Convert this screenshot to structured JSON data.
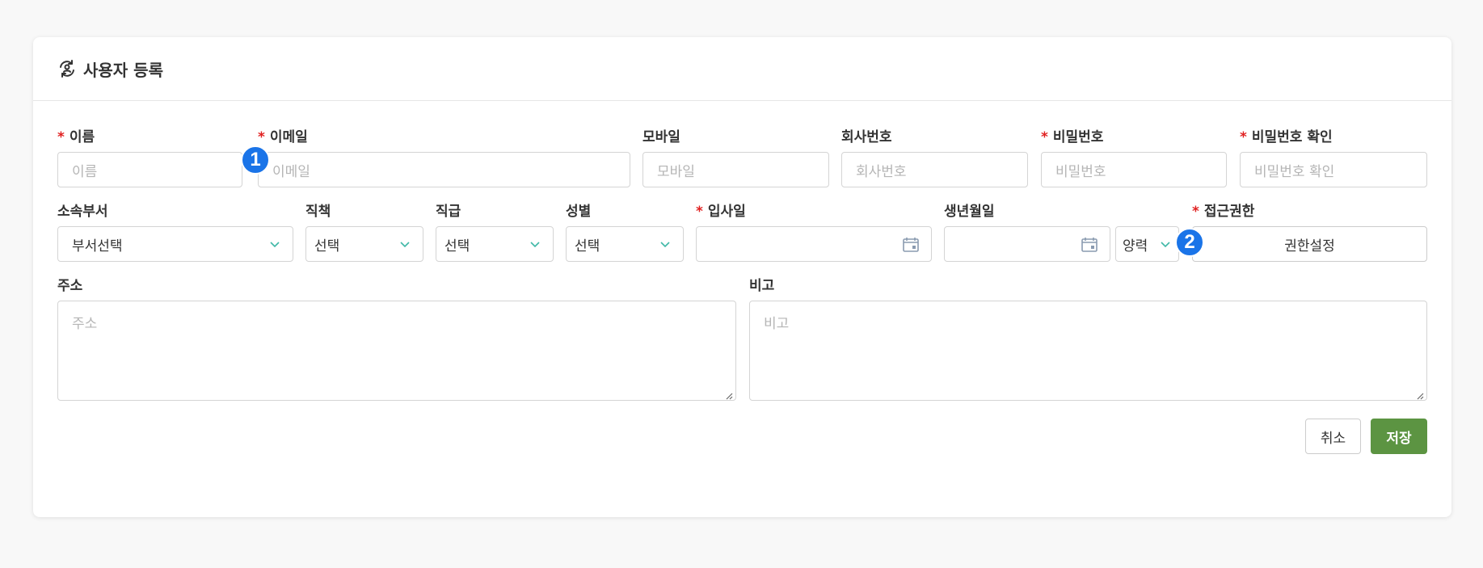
{
  "header": {
    "title": "사용자 등록",
    "icon": "user-sync-icon"
  },
  "form": {
    "row1": {
      "name": {
        "label": "이름",
        "required": "*",
        "placeholder": "이름"
      },
      "email": {
        "label": "이메일",
        "required": "*",
        "placeholder": "이메일"
      },
      "mobile": {
        "label": "모바일",
        "placeholder": "모바일"
      },
      "company_no": {
        "label": "회사번호",
        "placeholder": "회사번호"
      },
      "password": {
        "label": "비밀번호",
        "required": "*",
        "placeholder": "비밀번호"
      },
      "password_confirm": {
        "label": "비밀번호 확인",
        "required": "*",
        "placeholder": "비밀번호 확인"
      }
    },
    "row2": {
      "department": {
        "label": "소속부서",
        "value": "부서선택"
      },
      "duty": {
        "label": "직책",
        "value": "선택"
      },
      "rank": {
        "label": "직급",
        "value": "선택"
      },
      "gender": {
        "label": "성별",
        "value": "선택"
      },
      "hire_date": {
        "label": "입사일",
        "required": "*",
        "value": ""
      },
      "birth_date": {
        "label": "생년월일",
        "value": ""
      },
      "calendar_type": {
        "value": "양력"
      },
      "access": {
        "label": "접근권한",
        "required": "*",
        "button_label": "권한설정"
      }
    },
    "row3": {
      "address": {
        "label": "주소",
        "placeholder": "주소"
      },
      "note": {
        "label": "비고",
        "placeholder": "비고"
      }
    }
  },
  "badges": {
    "first": "1",
    "second": "2"
  },
  "buttons": {
    "cancel": "취소",
    "save": "저장"
  },
  "colors": {
    "required": "#e02020",
    "save": "#5c9442",
    "badge": "#1a74e8",
    "chevron": "#3fb8a7"
  }
}
